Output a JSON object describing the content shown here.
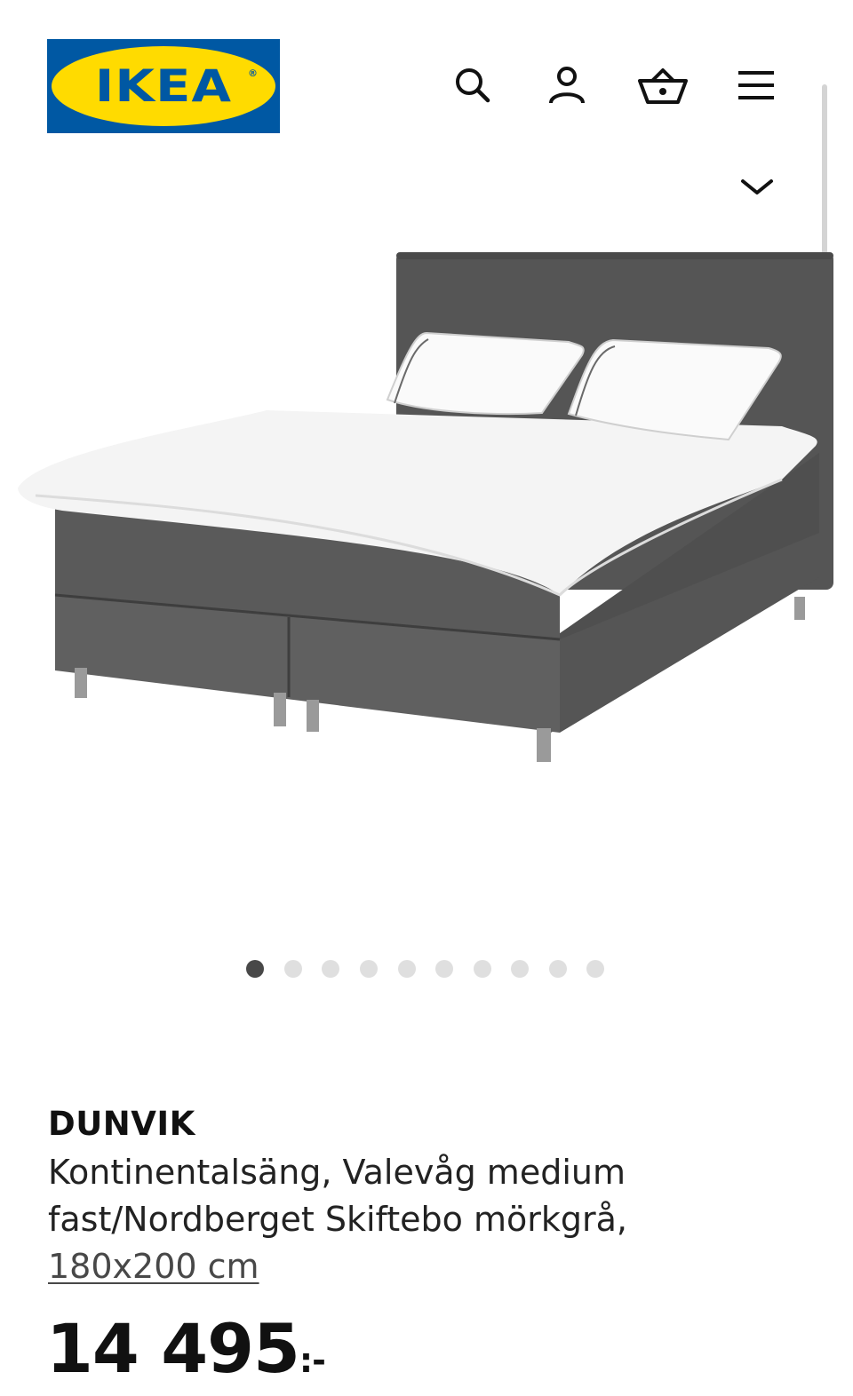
{
  "header": {
    "logo_text": "IKEA",
    "logo_registered": "®",
    "icons": [
      "search-icon",
      "account-icon",
      "cart-icon",
      "menu-icon"
    ]
  },
  "colors": {
    "brand_blue": "#0058a3",
    "brand_yellow": "#ffdb00",
    "dot_active": "#484848",
    "dot_inactive": "#dfdfdf"
  },
  "gallery": {
    "image_count": 10,
    "active_index": 0
  },
  "product": {
    "name": "DUNVIK",
    "description_line1": "Kontinentalsäng, Valevåg medium",
    "description_line2": "fast/Nordberget Skiftebo mörkgrå,",
    "size": "180x200 cm",
    "price": "14 495",
    "price_suffix": ":-"
  }
}
